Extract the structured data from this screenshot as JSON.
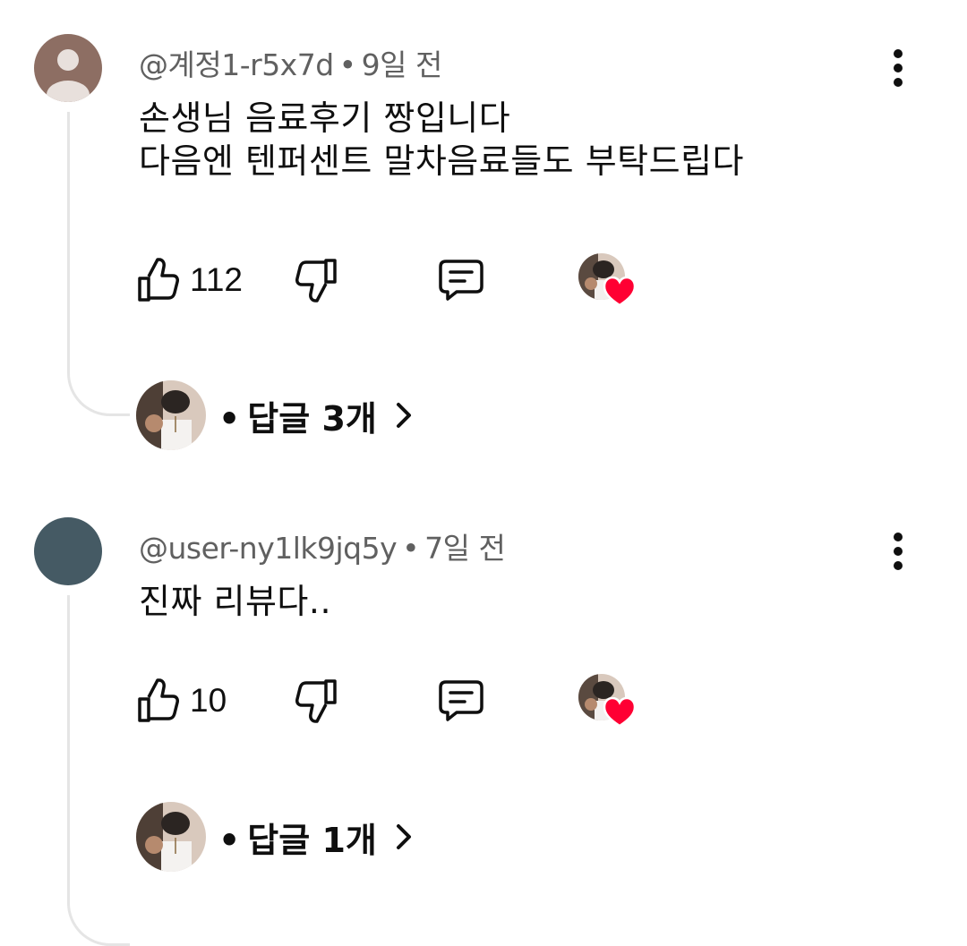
{
  "comments": [
    {
      "author": "@계정1-r5x7d",
      "separator": "•",
      "age": "9일 전",
      "lines": [
        "손생님 음료후기 짱입니다",
        "다음엔 텐퍼센트 말차음료들도 부탁드립다"
      ],
      "likes": "112",
      "avatar_color": "#8d6e63",
      "reply_bullet": "•",
      "replies_label": "답글 3개",
      "hearted": true
    },
    {
      "author": "@user-ny1lk9jq5y",
      "separator": "•",
      "age": "7일 전",
      "lines": [
        "진짜 리뷰다.."
      ],
      "likes": "10",
      "avatar_color": "#455a64",
      "reply_bullet": "•",
      "replies_label": "답글 1개",
      "hearted": true
    }
  ],
  "icons": {
    "like": "thumb-up-icon",
    "dislike": "thumb-down-icon",
    "reply": "comment-icon",
    "more": "more-vert-icon",
    "heart": "heart-icon",
    "chevron": "chevron-right-icon"
  },
  "colors": {
    "heart": "#ff0033",
    "meta_text": "#606060",
    "thread_line": "#e5e5e5"
  }
}
